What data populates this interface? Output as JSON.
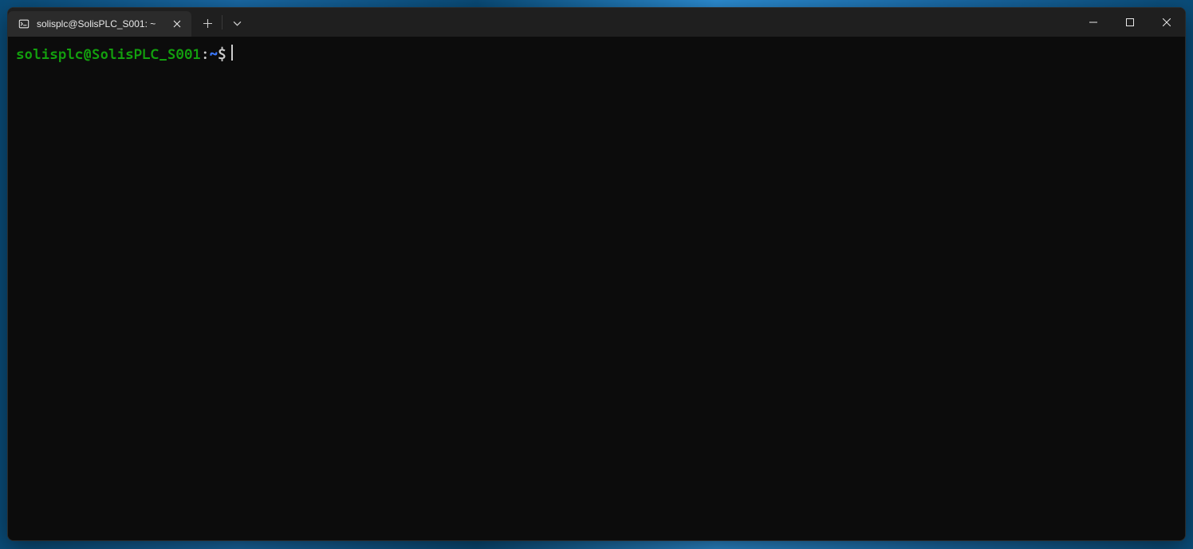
{
  "tab": {
    "title": "solisplc@SolisPLC_S001: ~"
  },
  "prompt": {
    "user_host": "solisplc@SolisPLC_S001",
    "sep": ":",
    "path": "~",
    "symbol": "$"
  }
}
